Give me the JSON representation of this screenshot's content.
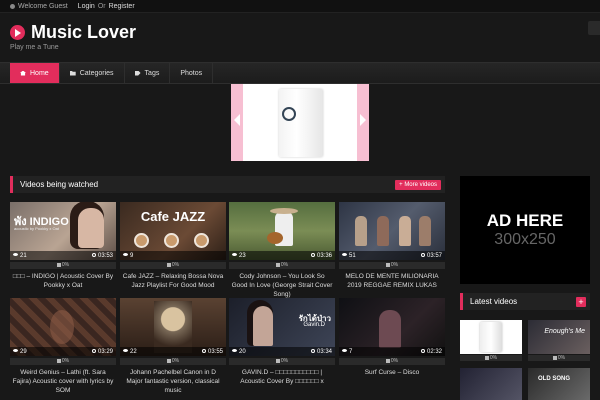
{
  "topbar": {
    "welcome": "Welcome Guest",
    "login": "Login",
    "or": "Or",
    "register": "Register"
  },
  "header": {
    "title": "Music Lover",
    "tagline": "Play me a Tune"
  },
  "nav": [
    {
      "label": "Home",
      "icon": "home-icon",
      "active": true
    },
    {
      "label": "Categories",
      "icon": "folder-icon"
    },
    {
      "label": "Tags",
      "icon": "tag-icon"
    },
    {
      "label": "Photos"
    }
  ],
  "main": {
    "section_title": "Videos being watched",
    "more_label": "More videos",
    "videos": [
      {
        "title": "□□□ – INDIGO | Acoustic Cover By Pookky x Oat",
        "views": "21",
        "duration": "03:53",
        "rating": "0%",
        "thumb_text": "พัง INDIGO",
        "thumb_sub": "acoustic by Pookky x Oat"
      },
      {
        "title": "Cafe JAZZ – Relaxing Bossa Nova Jazz Playlist For Good Mood",
        "views": "9",
        "duration": "",
        "rating": "0%",
        "thumb_text": "Cafe JAZZ"
      },
      {
        "title": "Cody Johnson – You Look So Good In Love (George Strait Cover Song)",
        "views": "23",
        "duration": "03:36",
        "rating": "0%"
      },
      {
        "title": "MELO DE MENTE MILIONARIA 2019 REGGAE REMIX LUKAS",
        "views": "51",
        "duration": "03:57",
        "rating": "0%"
      },
      {
        "title": "Weird Genius – Lathi (ft. Sara Fajira) Acoustic cover with lyrics by SOM",
        "views": "29",
        "duration": "03:29",
        "rating": "0%"
      },
      {
        "title": "Johann Pachelbel Canon in D Major fantastic version, classical music",
        "views": "22",
        "duration": "03:55",
        "rating": "0%"
      },
      {
        "title": "GAVIN.D – □□□□□□□□□□□ | Acoustic Cover By □□□□□□ x",
        "views": "20",
        "duration": "03:34",
        "rating": "0%",
        "thumb_text": "รักได้ป่าว",
        "thumb_sub": "Gavin.D"
      },
      {
        "title": "Surf Curse – Disco",
        "views": "7",
        "duration": "02:32",
        "rating": "0%"
      }
    ]
  },
  "sidebar": {
    "ad_line1": "AD HERE",
    "ad_line2": "300x250",
    "latest_title": "Latest videos",
    "plus_label": "+",
    "latest": [
      {
        "rating": "0%"
      },
      {
        "rating": "0%",
        "thumb_text": "Enough's Me"
      },
      {
        "rating": ""
      },
      {
        "rating": "",
        "thumb_text": "OLD SONG"
      }
    ]
  },
  "colors": {
    "accent": "#e22d5c",
    "background": "#181818"
  }
}
